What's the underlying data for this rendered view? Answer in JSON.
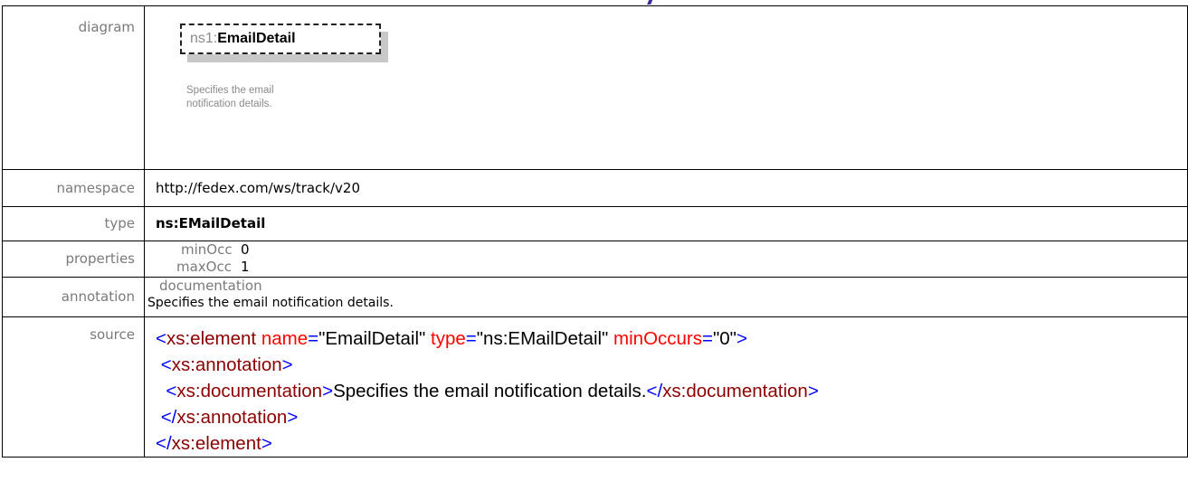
{
  "labels": {
    "diagram": "diagram",
    "namespace": "namespace",
    "type": "type",
    "properties": "properties",
    "annotation": "annotation",
    "source": "source"
  },
  "diagram": {
    "ns_prefix": "ns1:",
    "element_name": "EmailDetail",
    "description": "Specifies the email notification details."
  },
  "namespace": "http://fedex.com/ws/track/v20",
  "type": "ns:EMailDetail",
  "properties": {
    "min_label": "minOcc",
    "min_value": "0",
    "max_label": "maxOcc",
    "max_value": "1"
  },
  "annotation": {
    "key": "documentation",
    "value": "Specifies the email notification details."
  },
  "source": {
    "line1": {
      "open": "<",
      "tag": "xs:element",
      "attr1": " name",
      "eq1": "=",
      "v1": "\"EmailDetail\"",
      "attr2": " type",
      "eq2": "=",
      "v2": "\"ns:EMailDetail\"",
      "attr3": " minOccurs",
      "eq3": "=",
      "v3": "\"0\"",
      "close": ">"
    },
    "line2": {
      "open": "<",
      "tag": "xs:annotation",
      "close": ">"
    },
    "line3": {
      "open": "<",
      "tag": "xs:documentation",
      "close": ">",
      "text": "Specifies the email notification details.",
      "end_open": "</",
      "end_tag": "xs:documentation",
      "end_close": ">"
    },
    "line4": {
      "open": "</",
      "tag": "xs:annotation",
      "close": ">"
    },
    "line5": {
      "open": "</",
      "tag": "xs:element",
      "close": ">"
    }
  }
}
